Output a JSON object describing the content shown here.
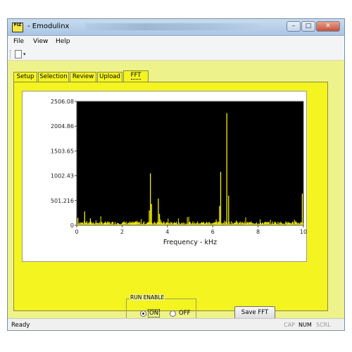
{
  "window": {
    "title": "- Emodulinx",
    "icon_text": "FIZ"
  },
  "titlebar_buttons": {
    "minimize": "–",
    "maximize": "□",
    "close": "✕"
  },
  "menu": {
    "file": "File",
    "view": "View",
    "help": "Help"
  },
  "toolbar": {
    "new_icon": "new-document-icon",
    "dropdown": "▾"
  },
  "tabs": [
    {
      "label": "Setup",
      "active": false
    },
    {
      "label": "Selection",
      "active": false
    },
    {
      "label": "Review",
      "active": false
    },
    {
      "label": "Upload",
      "active": false
    },
    {
      "label": "FFT",
      "active": true
    }
  ],
  "chart_data": {
    "type": "bar",
    "xlabel": "Frequency - kHz",
    "ylabel": "",
    "xlim": [
      0,
      10
    ],
    "ylim": [
      0,
      2506.08
    ],
    "x_ticks": [
      "0",
      "2",
      "4",
      "6",
      "8",
      "10"
    ],
    "y_ticks": [
      "0",
      "501.216",
      "1002.43",
      "1503.65",
      "2004.86",
      "2506.08"
    ],
    "background": "#000000",
    "bar_color": "#f5f000",
    "peaks": [
      {
        "x": 0.05,
        "y": 150
      },
      {
        "x": 0.35,
        "y": 280
      },
      {
        "x": 0.6,
        "y": 140
      },
      {
        "x": 3.2,
        "y": 300
      },
      {
        "x": 3.3,
        "y": 430
      },
      {
        "x": 3.25,
        "y": 1050
      },
      {
        "x": 3.6,
        "y": 540
      },
      {
        "x": 3.65,
        "y": 230
      },
      {
        "x": 6.3,
        "y": 390
      },
      {
        "x": 6.35,
        "y": 1080
      },
      {
        "x": 6.62,
        "y": 2270
      },
      {
        "x": 6.7,
        "y": 600
      },
      {
        "x": 9.95,
        "y": 640
      }
    ]
  },
  "run_enable": {
    "label": "RUN ENABLE",
    "on": "ON",
    "off": "OFF",
    "selected": "ON"
  },
  "save_button": "Save FFT",
  "status": {
    "text": "Ready",
    "cap": "CAP",
    "num": "NUM",
    "scrl": "SCRL"
  }
}
